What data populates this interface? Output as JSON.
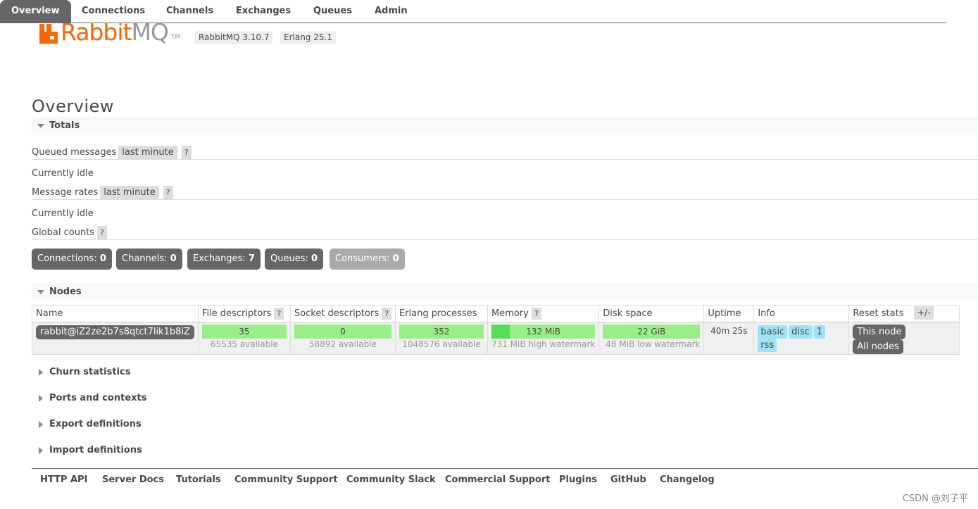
{
  "header": {
    "logo_word_a": "Rabbit",
    "logo_word_b": "MQ",
    "logo_tm": "TM",
    "version": "RabbitMQ 3.10.7",
    "erlang": "Erlang 25.1",
    "brand_color": "#ff6600"
  },
  "tabs": [
    "Overview",
    "Connections",
    "Channels",
    "Exchanges",
    "Queues",
    "Admin"
  ],
  "page_title": "Overview",
  "totals": {
    "section": "Totals",
    "queued_label": "Queued messages",
    "queued_range": "last minute",
    "help": "?",
    "queued_status": "Currently idle",
    "rates_label": "Message rates",
    "rates_range": "last minute",
    "rates_status": "Currently idle",
    "global_label": "Global counts"
  },
  "counts": [
    {
      "label": "Connections:",
      "value": "0"
    },
    {
      "label": "Channels:",
      "value": "0"
    },
    {
      "label": "Exchanges:",
      "value": "7"
    },
    {
      "label": "Queues:",
      "value": "0"
    },
    {
      "label": "Consumers:",
      "value": "0"
    }
  ],
  "nodes": {
    "section": "Nodes",
    "toggle": "+/-",
    "headers": [
      "Name",
      "File descriptors",
      "Socket descriptors",
      "Erlang processes",
      "Memory",
      "Disk space",
      "Uptime",
      "Info",
      "Reset stats"
    ],
    "row": {
      "name": "rabbit@iZ2ze2b7s8qtct7lik1b8iZ",
      "fd": "35",
      "fd_sub": "65535 available",
      "sd": "0",
      "sd_sub": "58892 available",
      "ep": "352",
      "ep_sub": "1048576 available",
      "mem": "132 MiB",
      "mem_sub": "731 MiB high watermark",
      "mem_fraction": 0.18,
      "disk": "22 GiB",
      "disk_sub": "48 MiB low watermark",
      "uptime": "40m 25s",
      "info": [
        "basic",
        "disc",
        "1",
        "rss"
      ],
      "reset_this": "This node",
      "reset_all": "All nodes"
    }
  },
  "collapsed_sections": [
    "Churn statistics",
    "Ports and contexts",
    "Export definitions",
    "Import definitions"
  ],
  "footer": [
    "HTTP API",
    "Server Docs",
    "Tutorials",
    "Community Support",
    "Community Slack",
    "Commercial Support",
    "Plugins",
    "GitHub",
    "Changelog"
  ],
  "watermark": "CSDN @刘子平"
}
